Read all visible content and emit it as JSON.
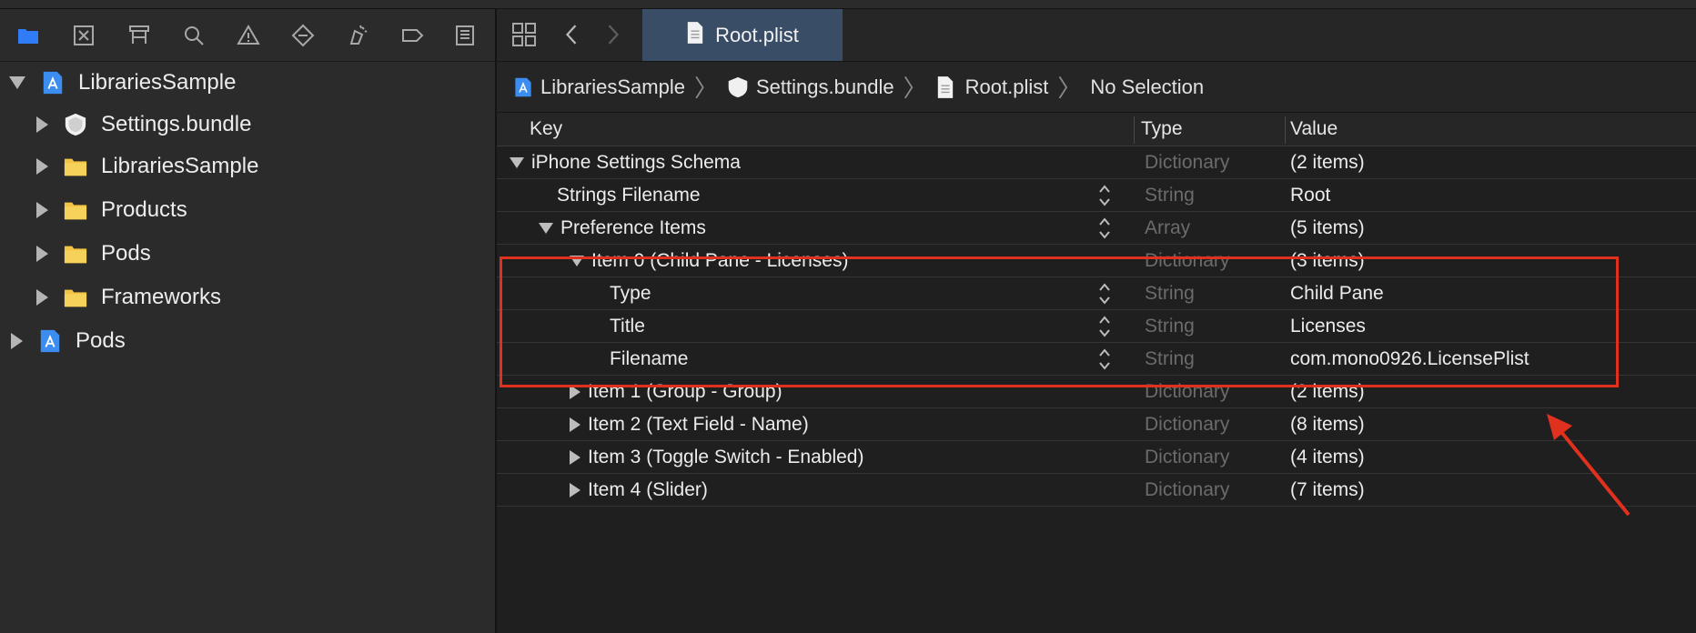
{
  "navigator": {
    "toolbar_icons": [
      "folder-icon",
      "source-control-icon",
      "hierarchy-icon",
      "search-icon",
      "warning-icon",
      "test-icon",
      "debug-icon",
      "breakpoint-icon",
      "report-icon"
    ],
    "tree": [
      {
        "label": "LibrariesSample",
        "expanded": true,
        "icon": "project-icon",
        "level": 0
      },
      {
        "label": "Settings.bundle",
        "expanded": false,
        "icon": "bundle-icon",
        "level": 1
      },
      {
        "label": "LibrariesSample",
        "expanded": false,
        "icon": "folder-icon",
        "level": 1
      },
      {
        "label": "Products",
        "expanded": false,
        "icon": "folder-icon",
        "level": 1
      },
      {
        "label": "Pods",
        "expanded": false,
        "icon": "folder-icon",
        "level": 1
      },
      {
        "label": "Frameworks",
        "expanded": false,
        "icon": "folder-icon",
        "level": 1
      },
      {
        "label": "Pods",
        "expanded": false,
        "icon": "project-icon",
        "level": 0
      }
    ]
  },
  "editor": {
    "tab_label": "Root.plist",
    "breadcrumb": [
      "LibrariesSample",
      "Settings.bundle",
      "Root.plist",
      "No Selection"
    ],
    "columns": {
      "key": "Key",
      "type": "Type",
      "value": "Value"
    },
    "rows": [
      {
        "key": "iPhone Settings Schema",
        "type": "Dictionary",
        "value": "(2 items)",
        "indent": 0,
        "disclosure": "down",
        "stepper": false
      },
      {
        "key": "Strings Filename",
        "type": "String",
        "value": "Root",
        "indent": 1,
        "disclosure": "none",
        "stepper": true
      },
      {
        "key": "Preference Items",
        "type": "Array",
        "value": "(5 items)",
        "indent": 1,
        "disclosure": "down",
        "stepper": true
      },
      {
        "key": "Item 0 (Child Pane - Licenses)",
        "type": "Dictionary",
        "value": "(3 items)",
        "indent": 2,
        "disclosure": "down",
        "stepper": false
      },
      {
        "key": "Type",
        "type": "String",
        "value": "Child Pane",
        "indent": 3,
        "disclosure": "none",
        "stepper": true
      },
      {
        "key": "Title",
        "type": "String",
        "value": "Licenses",
        "indent": 3,
        "disclosure": "none",
        "stepper": true
      },
      {
        "key": "Filename",
        "type": "String",
        "value": "com.mono0926.LicensePlist",
        "indent": 3,
        "disclosure": "none",
        "stepper": true
      },
      {
        "key": "Item 1 (Group - Group)",
        "type": "Dictionary",
        "value": "(2 items)",
        "indent": 2,
        "disclosure": "right",
        "stepper": false
      },
      {
        "key": "Item 2 (Text Field - Name)",
        "type": "Dictionary",
        "value": "(8 items)",
        "indent": 2,
        "disclosure": "right",
        "stepper": false
      },
      {
        "key": "Item 3 (Toggle Switch - Enabled)",
        "type": "Dictionary",
        "value": "(4 items)",
        "indent": 2,
        "disclosure": "right",
        "stepper": false
      },
      {
        "key": "Item 4 (Slider)",
        "type": "Dictionary",
        "value": "(7 items)",
        "indent": 2,
        "disclosure": "right",
        "stepper": false
      }
    ]
  },
  "annotation": {
    "color": "#e0301e"
  }
}
